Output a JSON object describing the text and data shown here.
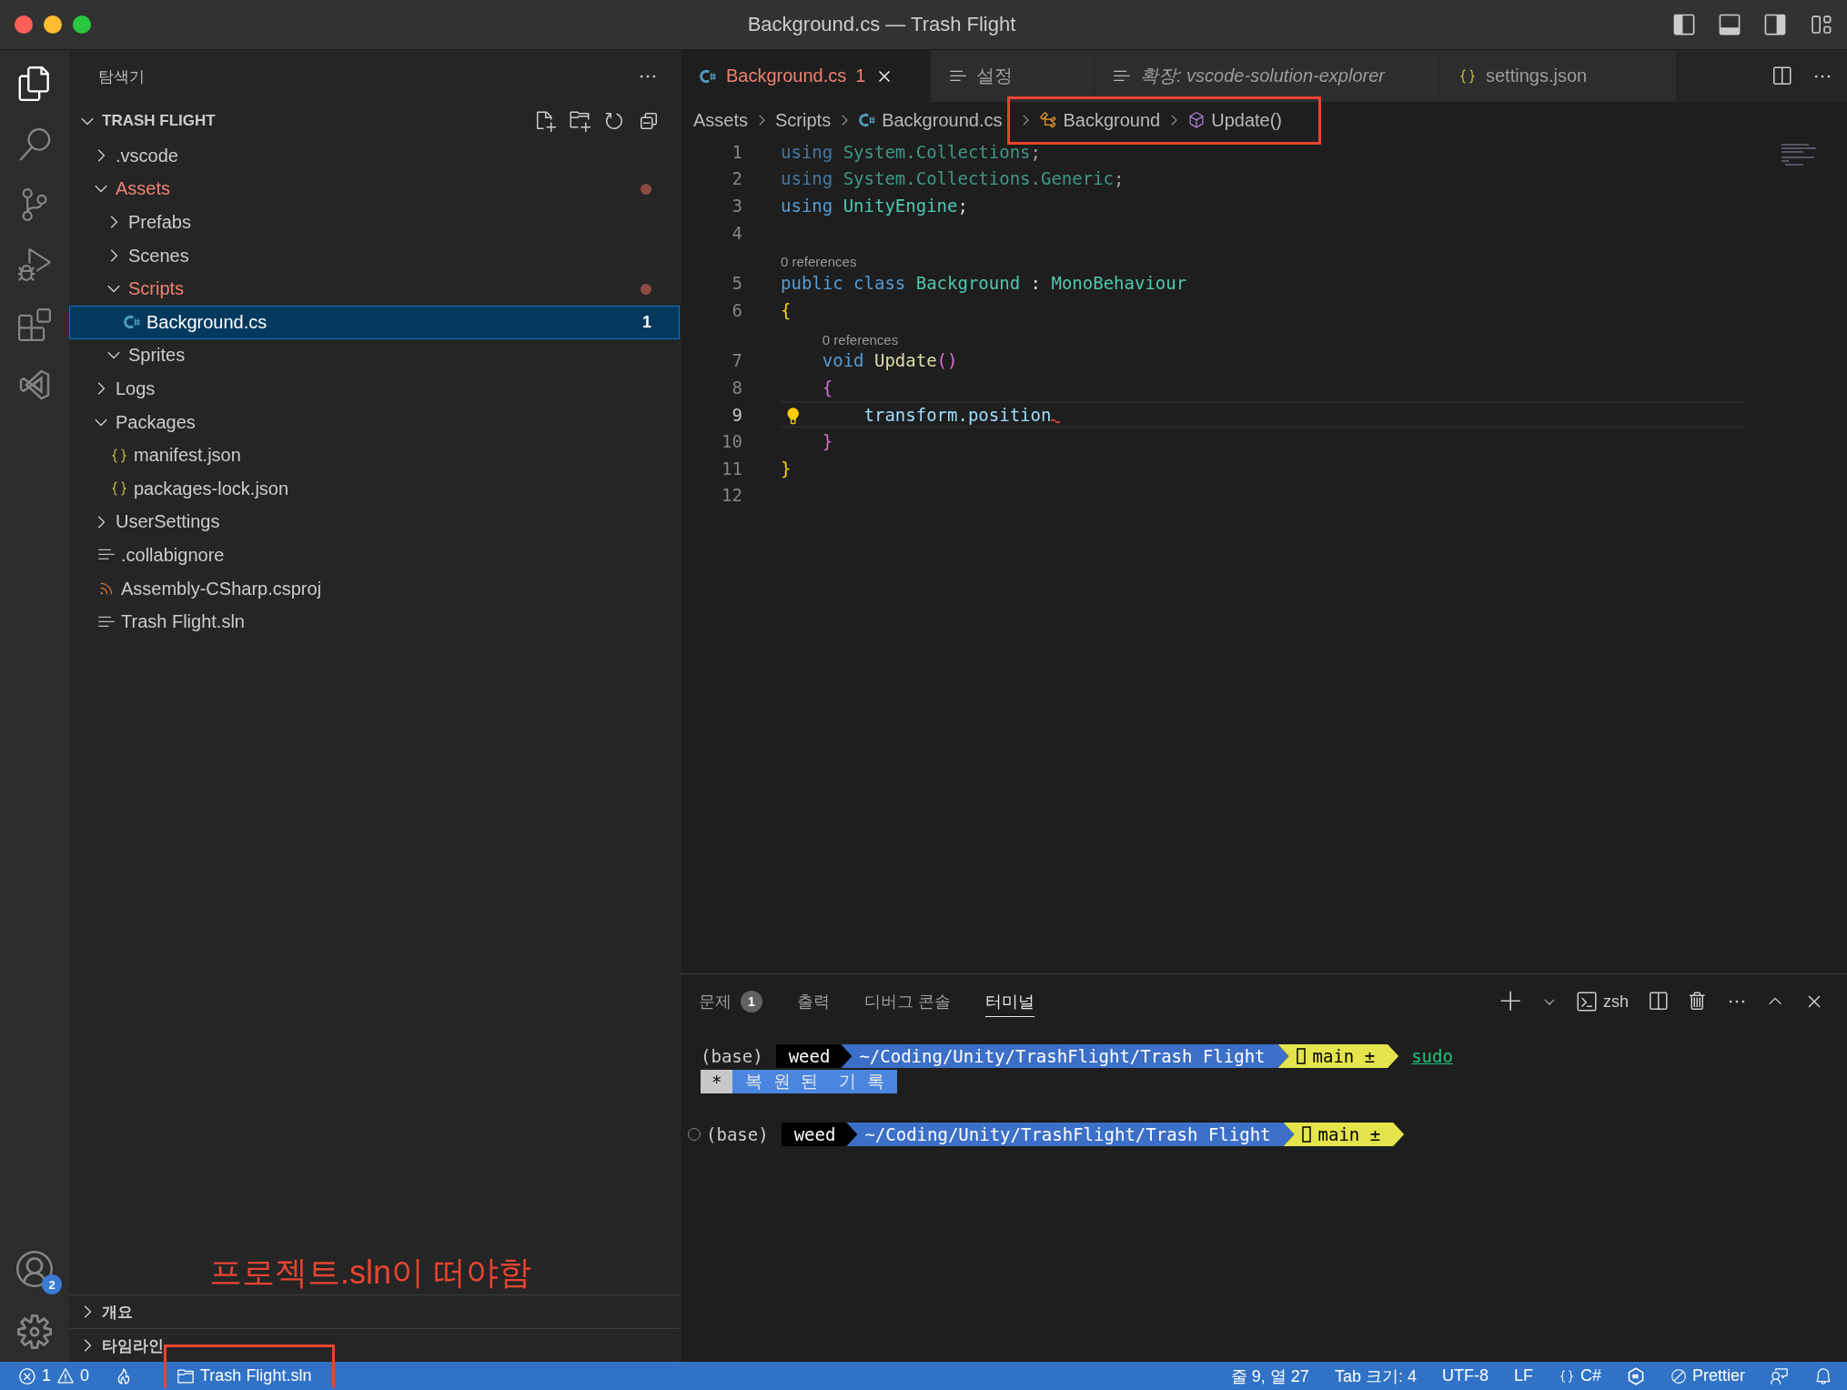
{
  "window": {
    "title": "Background.cs — Trash Flight"
  },
  "activity_bar": {
    "items": [
      {
        "kind": "explorer",
        "selected": true
      },
      {
        "kind": "search",
        "selected": false
      },
      {
        "kind": "source-control",
        "selected": false
      },
      {
        "kind": "run-debug",
        "selected": false
      },
      {
        "kind": "extensions",
        "selected": false
      },
      {
        "kind": "visual-studio",
        "selected": false
      }
    ],
    "accounts_badge": "2"
  },
  "sidebar": {
    "title": "탐색기",
    "root": {
      "label": "TRASH FLIGHT",
      "expanded": true
    },
    "tree": [
      {
        "label": ".vscode",
        "kind": "folder",
        "expanded": false,
        "has_problems": false,
        "selected": false
      },
      {
        "label": "Assets",
        "kind": "folder",
        "expanded": true,
        "has_problems": true,
        "selected": false,
        "children": [
          {
            "label": "Prefabs",
            "kind": "folder",
            "expanded": false,
            "has_problems": false,
            "selected": false
          },
          {
            "label": "Scenes",
            "kind": "folder",
            "expanded": false,
            "has_problems": false,
            "selected": false
          },
          {
            "label": "Scripts",
            "kind": "folder",
            "expanded": true,
            "has_problems": true,
            "selected": false,
            "children": [
              {
                "label": "Background.cs",
                "kind": "csharp",
                "has_problems": false,
                "selected": true,
                "badge": "1"
              }
            ]
          },
          {
            "label": "Sprites",
            "kind": "folder",
            "expanded": true,
            "has_problems": false,
            "selected": false
          }
        ]
      },
      {
        "label": "Logs",
        "kind": "folder",
        "expanded": false,
        "has_problems": false,
        "selected": false
      },
      {
        "label": "Packages",
        "kind": "folder",
        "expanded": true,
        "has_problems": false,
        "selected": false,
        "children": [
          {
            "label": "manifest.json",
            "kind": "json",
            "has_problems": false,
            "selected": false
          },
          {
            "label": "packages-lock.json",
            "kind": "json",
            "has_problems": false,
            "selected": false
          }
        ]
      },
      {
        "label": "UserSettings",
        "kind": "folder",
        "expanded": false,
        "has_problems": false,
        "selected": false
      },
      {
        "label": ".collabignore",
        "kind": "text",
        "has_problems": false,
        "selected": false
      },
      {
        "label": "Assembly-CSharp.csproj",
        "kind": "project",
        "has_problems": false,
        "selected": false
      },
      {
        "label": "Trash Flight.sln",
        "kind": "text",
        "has_problems": false,
        "selected": false
      }
    ],
    "sections": [
      {
        "label": "개요",
        "expanded": false
      },
      {
        "label": "타임라인",
        "expanded": false
      }
    ]
  },
  "annotation": {
    "note": "프로젝트.sln이 떠야함"
  },
  "editor": {
    "tabs": [
      {
        "label": "Background.cs",
        "kind": "csharp",
        "selected": true,
        "preview": false,
        "problems": "1"
      },
      {
        "label": "설정",
        "kind": "text",
        "selected": false,
        "preview": false
      },
      {
        "label": "확장: vscode-solution-explorer",
        "kind": "text",
        "selected": false,
        "preview": true
      },
      {
        "label": "settings.json",
        "kind": "json",
        "selected": false,
        "preview": false
      }
    ],
    "breadcrumb": [
      {
        "label": "Assets",
        "kind": "folder",
        "highlighted": false
      },
      {
        "label": "Scripts",
        "kind": "folder",
        "highlighted": false
      },
      {
        "label": "Background.cs",
        "kind": "csharp",
        "highlighted": false
      },
      {
        "label": "Background",
        "kind": "class",
        "highlighted": true
      },
      {
        "label": "Update()",
        "kind": "method",
        "highlighted": true
      }
    ],
    "lines": [
      {
        "number": "1",
        "current": false,
        "faded": true,
        "tokens": [
          {
            "text": "using",
            "kind": "keyword"
          },
          {
            "text": " System.Collections",
            "kind": "namespace"
          },
          {
            "text": ";",
            "kind": "punct"
          }
        ]
      },
      {
        "number": "2",
        "current": false,
        "faded": true,
        "tokens": [
          {
            "text": "using",
            "kind": "keyword"
          },
          {
            "text": " System.Collections.Generic",
            "kind": "namespace"
          },
          {
            "text": ";",
            "kind": "punct"
          }
        ]
      },
      {
        "number": "3",
        "current": false,
        "faded": false,
        "tokens": [
          {
            "text": "using",
            "kind": "keyword"
          },
          {
            "text": " UnityEngine",
            "kind": "namespace"
          },
          {
            "text": ";",
            "kind": "punct"
          }
        ]
      },
      {
        "number": "4",
        "current": false
      },
      {
        "number": "5",
        "current": false,
        "faded": false,
        "codelens": "0 references",
        "tokens": [
          {
            "text": "public class ",
            "kind": "keyword"
          },
          {
            "text": "Background",
            "kind": "type"
          },
          {
            "text": " : ",
            "kind": "punct"
          },
          {
            "text": "MonoBehaviour",
            "kind": "type"
          }
        ]
      },
      {
        "number": "6",
        "current": false,
        "faded": false,
        "tokens": [
          {
            "text": "{",
            "kind": "brace1"
          }
        ]
      },
      {
        "number": "7",
        "current": false,
        "faded": false,
        "codelens": "0 references",
        "tokens": [
          {
            "text": "    void ",
            "kind": "keyword"
          },
          {
            "text": "Update",
            "kind": "method"
          },
          {
            "text": "()",
            "kind": "brace2"
          }
        ]
      },
      {
        "number": "8",
        "current": false,
        "faded": false,
        "tokens": [
          {
            "text": "    {",
            "kind": "brace2"
          }
        ]
      },
      {
        "number": "9",
        "current": true,
        "faded": false,
        "lightbulb": true,
        "error": true,
        "tokens": [
          {
            "text": "        transform.position",
            "kind": "variable"
          }
        ]
      },
      {
        "number": "10",
        "current": false,
        "faded": false,
        "tokens": [
          {
            "text": "    }",
            "kind": "brace2"
          }
        ]
      },
      {
        "number": "11",
        "current": false,
        "faded": false,
        "tokens": [
          {
            "text": "}",
            "kind": "brace1"
          }
        ]
      },
      {
        "number": "12",
        "current": false
      }
    ]
  },
  "panel": {
    "tabs": [
      {
        "label": "문제",
        "badge": "1",
        "selected": false
      },
      {
        "label": "출력",
        "selected": false
      },
      {
        "label": "디버그 콘솔",
        "selected": false
      },
      {
        "label": "터미널",
        "selected": true
      }
    ],
    "shell": "zsh",
    "terminal": [
      {
        "marker": false,
        "segments": [
          {
            "text": "(base)",
            "kind": "plain"
          },
          {
            "text": "weed",
            "kind": "user"
          },
          {
            "text": "~/Coding/Unity/TrashFlight/Trash Flight",
            "kind": "path"
          },
          {
            "text": "main ±",
            "kind": "git"
          },
          {
            "text": "sudo",
            "kind": "suggestion"
          }
        ]
      },
      {
        "marker": false,
        "segments": [
          {
            "text": "*",
            "kind": "history-mark"
          },
          {
            "text": "복 원 된  기 록",
            "kind": "history"
          }
        ]
      },
      {
        "marker": true,
        "segments": [
          {
            "text": "(base)",
            "kind": "plain"
          },
          {
            "text": "weed",
            "kind": "user"
          },
          {
            "text": "~/Coding/Unity/TrashFlight/Trash Flight",
            "kind": "path"
          },
          {
            "text": "main ±",
            "kind": "git"
          }
        ]
      }
    ]
  },
  "status_bar": {
    "left": [
      {
        "kind": "problems",
        "errors": "1",
        "warnings": "0",
        "highlighted": false
      },
      {
        "kind": "flame"
      },
      {
        "kind": "folder",
        "label": "Trash Flight.sln",
        "highlighted": true
      }
    ],
    "right": [
      {
        "kind": "text",
        "label": "줄 9, 열 27"
      },
      {
        "kind": "text",
        "label": "Tab 크기: 4"
      },
      {
        "kind": "text",
        "label": "UTF-8"
      },
      {
        "kind": "text",
        "label": "LF"
      },
      {
        "kind": "language",
        "label": "C#"
      },
      {
        "kind": "omnisharp"
      },
      {
        "kind": "prettier",
        "label": "Prettier"
      },
      {
        "kind": "feedback"
      },
      {
        "kind": "bell"
      }
    ]
  }
}
